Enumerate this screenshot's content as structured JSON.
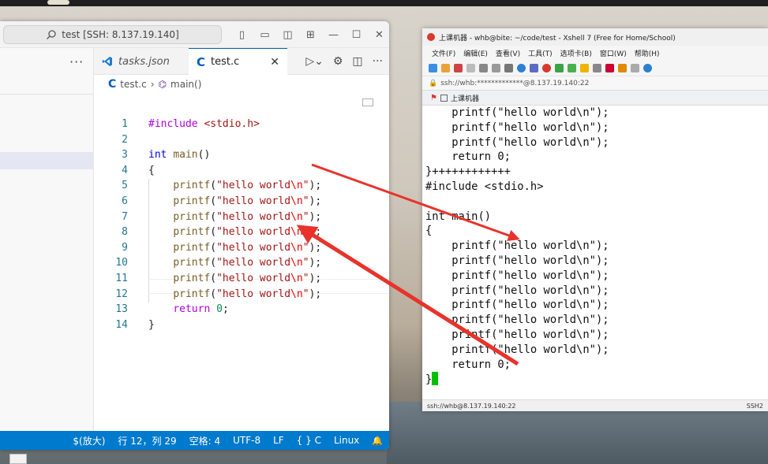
{
  "vscode": {
    "search_text": "test [SSH: 8.137.19.140]",
    "tabs": [
      {
        "label": "tasks.json"
      },
      {
        "label": "test.c",
        "close": "✕"
      }
    ],
    "breadcrumb": {
      "file": "test.c",
      "sep": "›",
      "symbol": "main()"
    },
    "sidebar_more": "···",
    "code_lines": [
      {
        "num": "1",
        "text": "#include <stdio.h>"
      },
      {
        "num": "2",
        "text": ""
      },
      {
        "num": "3",
        "text": "int main()"
      },
      {
        "num": "4",
        "text": "{"
      },
      {
        "num": "5",
        "text": "    printf(\"hello world\\n\");"
      },
      {
        "num": "6",
        "text": "    printf(\"hello world\\n\");"
      },
      {
        "num": "7",
        "text": "    printf(\"hello world\\n\");"
      },
      {
        "num": "8",
        "text": "    printf(\"hello world\\n\");"
      },
      {
        "num": "9",
        "text": "    printf(\"hello world\\n\");"
      },
      {
        "num": "10",
        "text": "    printf(\"hello world\\n\");"
      },
      {
        "num": "11",
        "text": "    printf(\"hello world\\n\");"
      },
      {
        "num": "12",
        "text": "    printf(\"hello world\\n\");"
      },
      {
        "num": "13",
        "text": "    return 0;"
      },
      {
        "num": "14",
        "text": "}"
      }
    ],
    "status": {
      "ime": "$(放大)",
      "position": "行 12，列 29",
      "spaces": "空格: 4",
      "encoding": "UTF-8",
      "eol": "LF",
      "language": "{ } C",
      "os": "Linux",
      "bell": "🔔"
    },
    "accent_color": "#007acc"
  },
  "xshell": {
    "title": "上课机器 - whb@bite: ~/code/test - Xshell 7 (Free for Home/School)",
    "menu": [
      "文件(F)",
      "编辑(E)",
      "查看(V)",
      "工具(T)",
      "选项卡(B)",
      "窗口(W)",
      "帮助(H)"
    ],
    "address": "ssh://whb:*************@8.137.19.140:22",
    "session_tab": "上课机器",
    "terminal_lines": [
      "    printf(\"hello world\\n\");",
      "    printf(\"hello world\\n\");",
      "    printf(\"hello world\\n\");",
      "    return 0;",
      "}++++++++++++",
      "#include <stdio.h>",
      "",
      "int main()",
      "{",
      "    printf(\"hello world\\n\");",
      "    printf(\"hello world\\n\");",
      "    printf(\"hello world\\n\");",
      "    printf(\"hello world\\n\");",
      "    printf(\"hello world\\n\");",
      "    printf(\"hello world\\n\");",
      "    printf(\"hello world\\n\");",
      "    printf(\"hello world\\n\");",
      "    return 0;",
      "}"
    ],
    "status_left": "ssh://whb@8.137.19.140:22",
    "status_right": "SSH2",
    "cursor_color": "#00c000"
  },
  "annotation_color": "#e8332b"
}
